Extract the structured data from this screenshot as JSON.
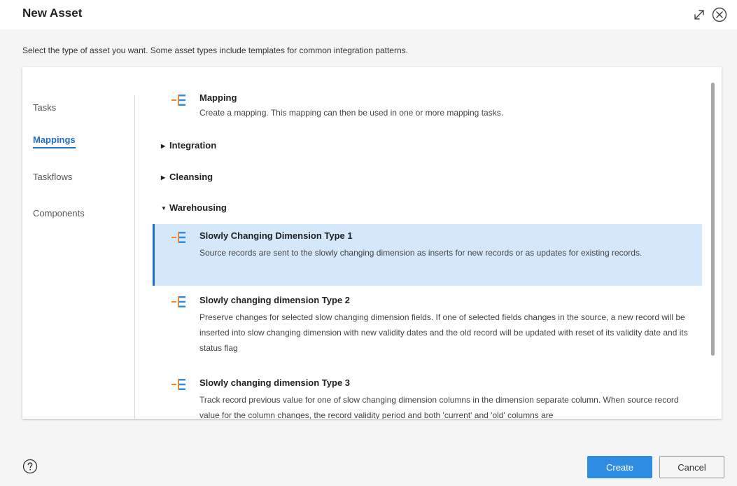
{
  "dialog": {
    "title": "New Asset",
    "instruction": "Select the type of asset you want. Some asset types include templates for common integration patterns."
  },
  "categories": [
    {
      "label": "Tasks",
      "active": false
    },
    {
      "label": "Mappings",
      "active": true
    },
    {
      "label": "Taskflows",
      "active": false
    },
    {
      "label": "Components",
      "active": false
    }
  ],
  "assets": {
    "mapping": {
      "title": "Mapping",
      "description": "Create a mapping. This mapping can then be used in one or more mapping tasks.",
      "icon": "mapping-icon"
    },
    "groups": [
      {
        "label": "Integration",
        "expanded": false
      },
      {
        "label": "Cleansing",
        "expanded": false
      },
      {
        "label": "Warehousing",
        "expanded": true
      }
    ],
    "warehousing": [
      {
        "title": "Slowly Changing Dimension Type 1",
        "description": "Source records are sent to the slowly changing dimension as inserts for new records or as updates for existing records.",
        "selected": true,
        "icon": "mapping-icon"
      },
      {
        "title": "Slowly changing dimension Type 2",
        "description": "Preserve changes for selected slow changing dimension fields. If one of selected fields changes in the source, a new record will be inserted into slow changing dimension with new validity dates and the old record will be updated with reset of its validity date and its status flag",
        "selected": false,
        "icon": "mapping-icon"
      },
      {
        "title": "Slowly changing dimension Type 3",
        "description": "Track record previous value for one of slow changing dimension columns in the dimension separate column. When source record value for the column changes, the record validity period and both 'current' and 'old' columns are",
        "selected": false,
        "icon": "mapping-icon"
      }
    ]
  },
  "footer": {
    "create_label": "Create",
    "cancel_label": "Cancel",
    "help_icon": "help-icon"
  },
  "colors": {
    "accent": "#1f6fc5",
    "button_primary": "#2e8de0",
    "selection": "#d4e8fa",
    "icon_blue": "#2c8ee8",
    "icon_orange": "#f08a2e"
  }
}
